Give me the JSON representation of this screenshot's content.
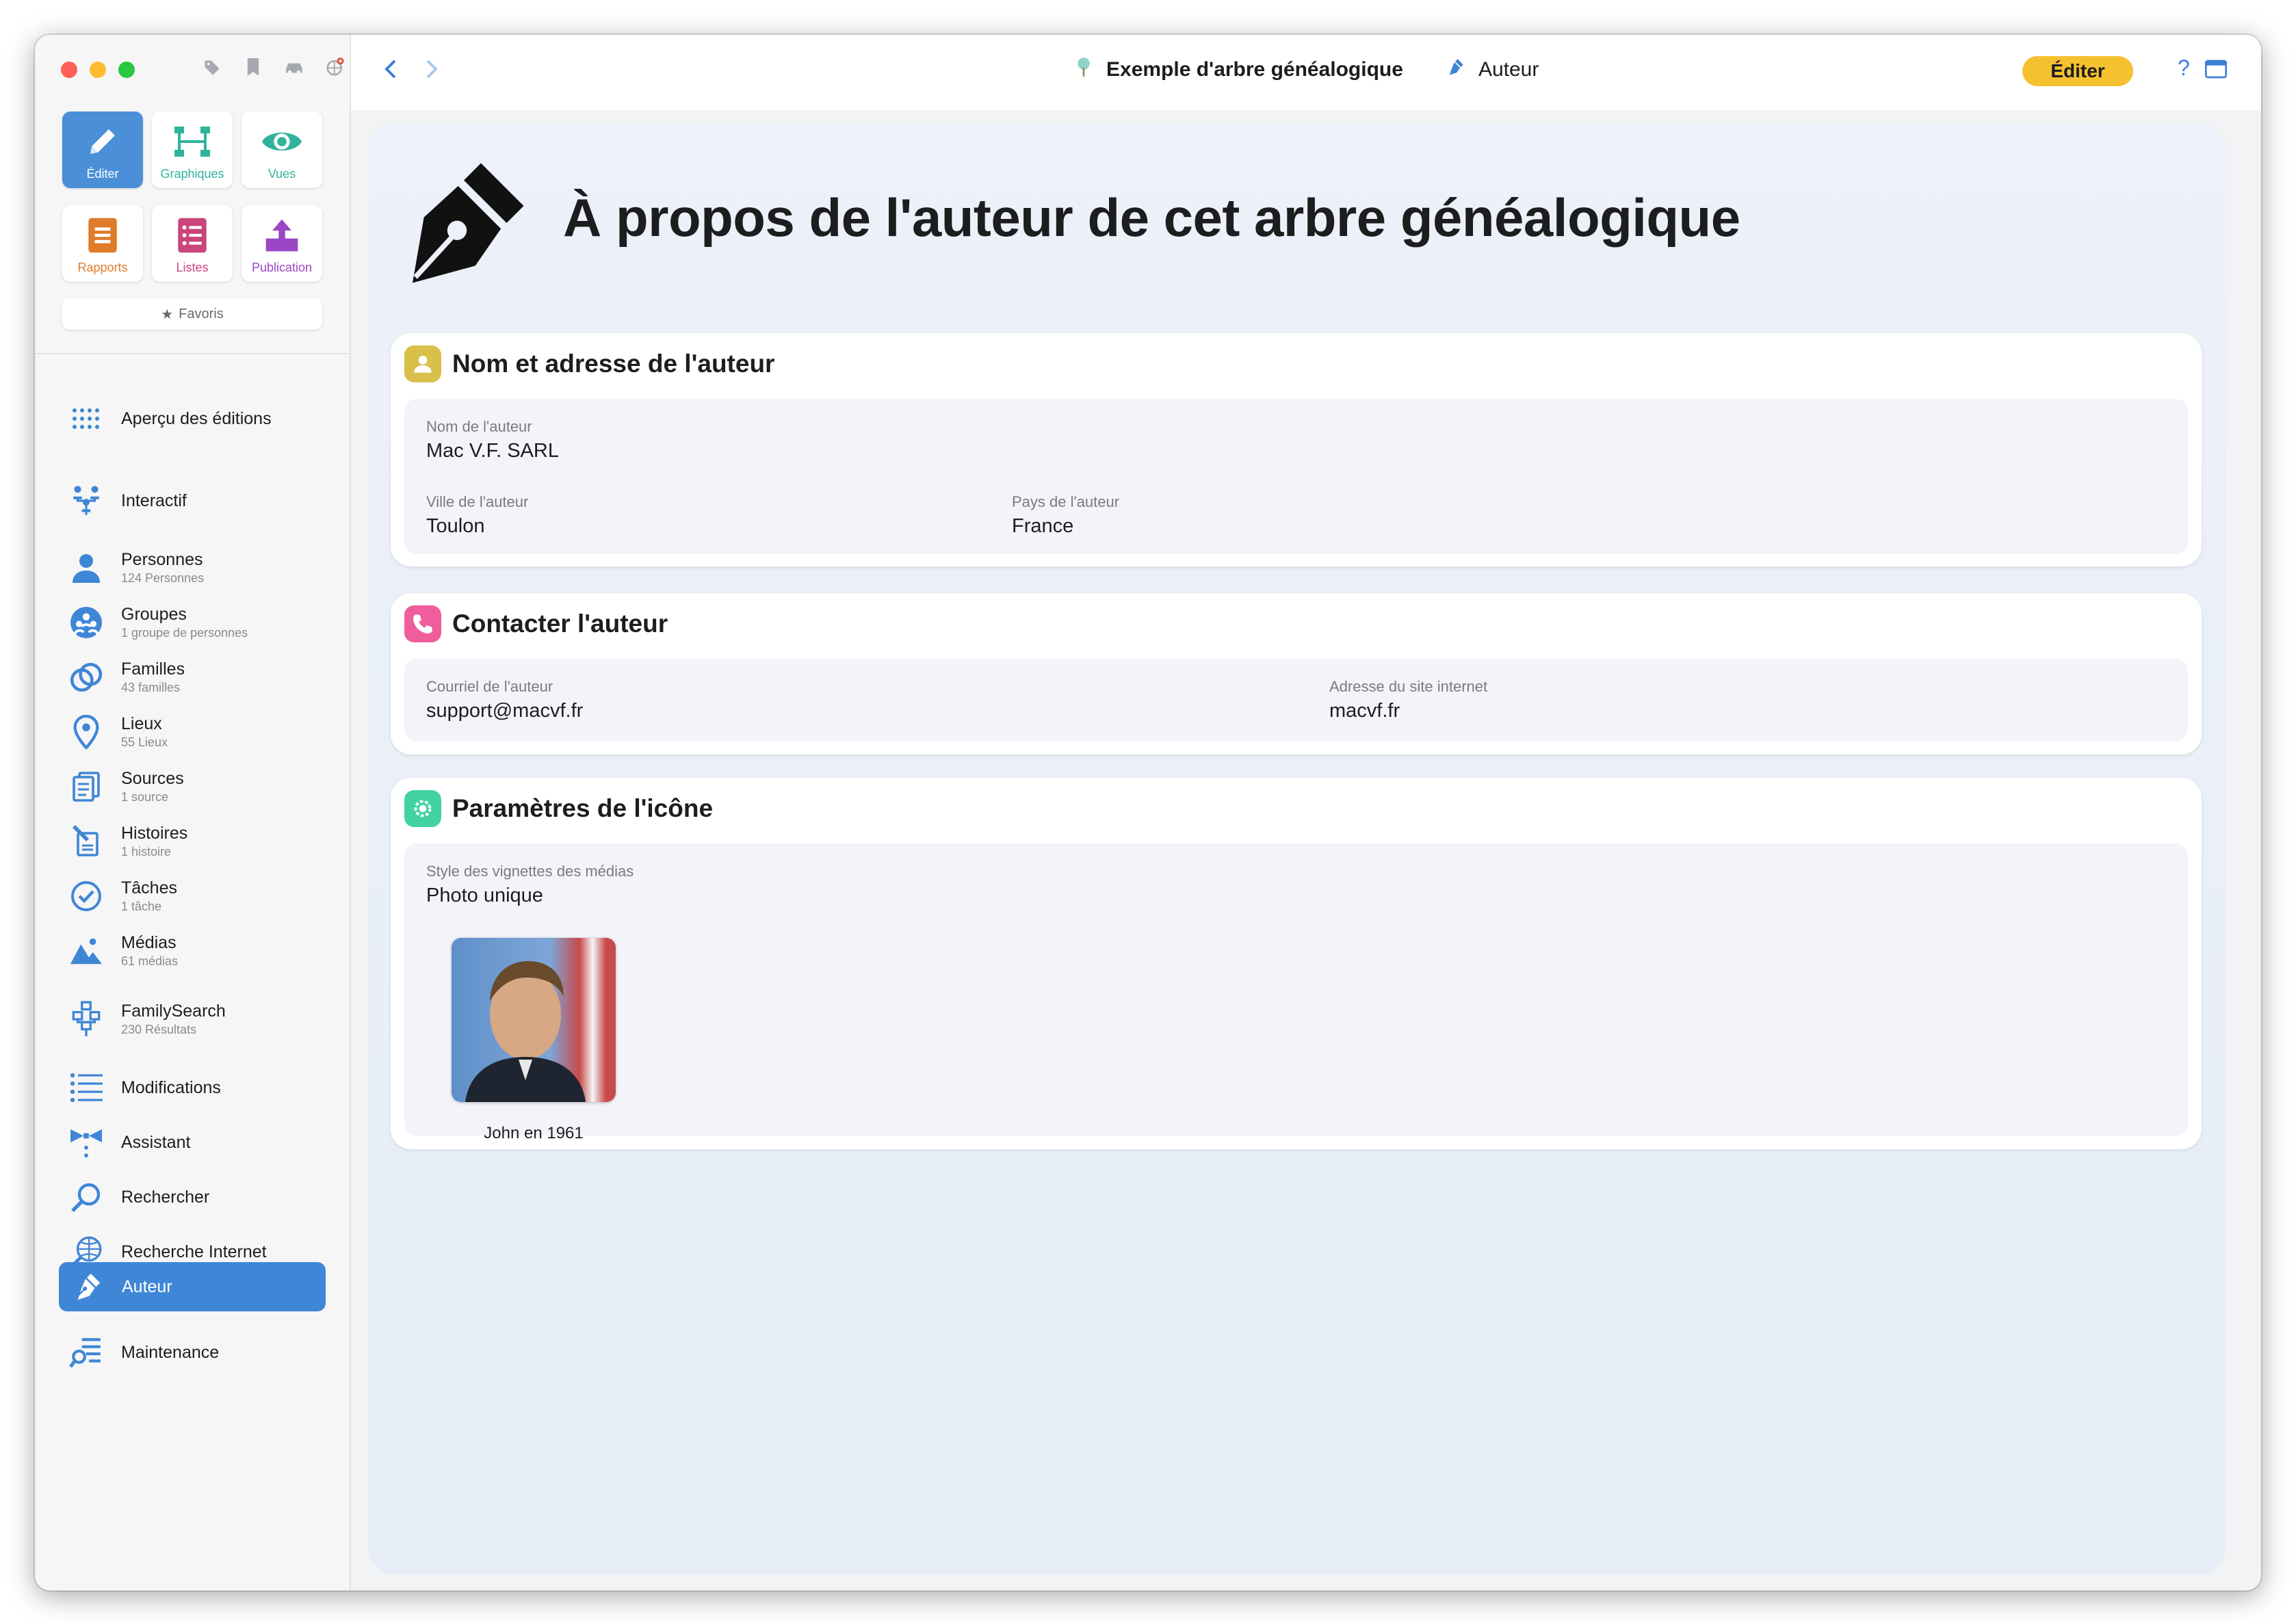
{
  "sidebar": {
    "tiles": [
      {
        "label": "Éditer",
        "icon": "pencil-icon",
        "color": "#ffffff"
      },
      {
        "label": "Graphiques",
        "icon": "tree-chart-icon",
        "color": "#2fb39c"
      },
      {
        "label": "Vues",
        "icon": "eye-icon",
        "color": "#2fb39c"
      },
      {
        "label": "Rapports",
        "icon": "report-icon",
        "color": "#e07b2a"
      },
      {
        "label": "Listes",
        "icon": "list-icon",
        "color": "#c9457c"
      },
      {
        "label": "Publication",
        "icon": "publish-icon",
        "color": "#9b46c4"
      }
    ],
    "favorites": "Favoris",
    "nav": [
      {
        "title": "Aperçu des éditions",
        "sub": ""
      },
      {
        "title": "Interactif",
        "sub": ""
      },
      {
        "title": "Personnes",
        "sub": "124 Personnes"
      },
      {
        "title": "Groupes",
        "sub": "1 groupe de personnes"
      },
      {
        "title": "Familles",
        "sub": "43 familles"
      },
      {
        "title": "Lieux",
        "sub": "55 Lieux"
      },
      {
        "title": "Sources",
        "sub": "1 source"
      },
      {
        "title": "Histoires",
        "sub": "1 histoire"
      },
      {
        "title": "Tâches",
        "sub": "1 tâche"
      },
      {
        "title": "Médias",
        "sub": "61 médias"
      },
      {
        "title": "FamilySearch",
        "sub": "230 Résultats"
      },
      {
        "title": "Modifications",
        "sub": ""
      },
      {
        "title": "Assistant",
        "sub": ""
      },
      {
        "title": "Rechercher",
        "sub": ""
      },
      {
        "title": "Recherche Internet",
        "sub": ""
      },
      {
        "title": "Auteur",
        "sub": ""
      },
      {
        "title": "Maintenance",
        "sub": ""
      }
    ]
  },
  "toolbar": {
    "breadcrumb_tree": "Exemple d'arbre généalogique",
    "breadcrumb_page": "Auteur",
    "edit_label": "Éditer",
    "help": "?"
  },
  "page": {
    "title": "À propos de l'auteur de cet arbre généalogique"
  },
  "card_author": {
    "title": "Nom et adresse de l'auteur",
    "name_label": "Nom de l'auteur",
    "name_value": "Mac V.F. SARL",
    "city_label": "Ville de l'auteur",
    "city_value": "Toulon",
    "country_label": "Pays de l'auteur",
    "country_value": "France"
  },
  "card_contact": {
    "title": "Contacter l'auteur",
    "email_label": "Courriel de l'auteur",
    "email_value": "support@macvf.fr",
    "site_label": "Adresse du site internet",
    "site_value": "macvf.fr"
  },
  "card_icon": {
    "title": "Paramètres de l'icône",
    "style_label": "Style des vignettes des médias",
    "style_value": "Photo unique",
    "photo_caption": "John en 1961"
  },
  "colors": {
    "accent": "#3f86d6",
    "edit_button": "#f5c12e",
    "badge_author": "#d8c04a",
    "badge_contact": "#ef5d9c",
    "badge_icon": "#43d3a3"
  }
}
